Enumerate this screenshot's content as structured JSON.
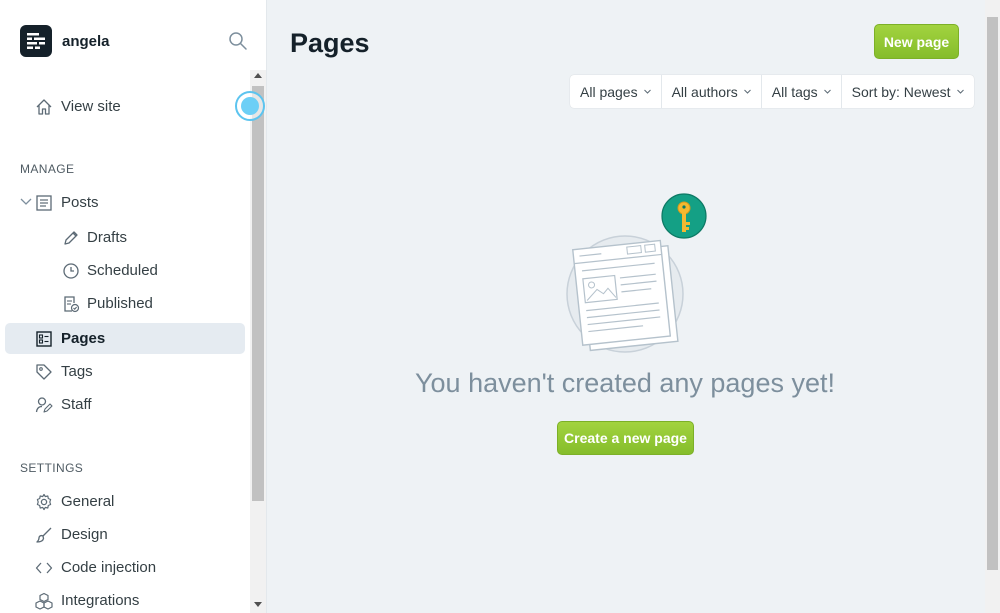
{
  "sidebar": {
    "site_name": "angela",
    "view_site": "View site",
    "manage_heading": "MANAGE",
    "settings_heading": "SETTINGS",
    "items": [
      {
        "label": "Posts",
        "icon": "posts-icon"
      },
      {
        "label": "Drafts",
        "icon": "pencil-icon"
      },
      {
        "label": "Scheduled",
        "icon": "clock-icon"
      },
      {
        "label": "Published",
        "icon": "published-icon"
      },
      {
        "label": "Pages",
        "icon": "pages-icon",
        "active": true
      },
      {
        "label": "Tags",
        "icon": "tag-icon"
      },
      {
        "label": "Staff",
        "icon": "staff-icon"
      }
    ],
    "settings_items": [
      {
        "label": "General",
        "icon": "gear-icon"
      },
      {
        "label": "Design",
        "icon": "brush-icon"
      },
      {
        "label": "Code injection",
        "icon": "code-icon"
      },
      {
        "label": "Integrations",
        "icon": "integrations-icon"
      }
    ]
  },
  "main": {
    "title": "Pages",
    "new_page_label": "New page",
    "filters": [
      "All pages",
      "All authors",
      "All tags",
      "Sort by: Newest"
    ],
    "empty_message": "You haven't created any pages yet!",
    "create_button": "Create a new page"
  },
  "colors": {
    "accent_green": "#9fcf3a",
    "key_badge": "#14a085",
    "key_gold": "#f5b930"
  }
}
